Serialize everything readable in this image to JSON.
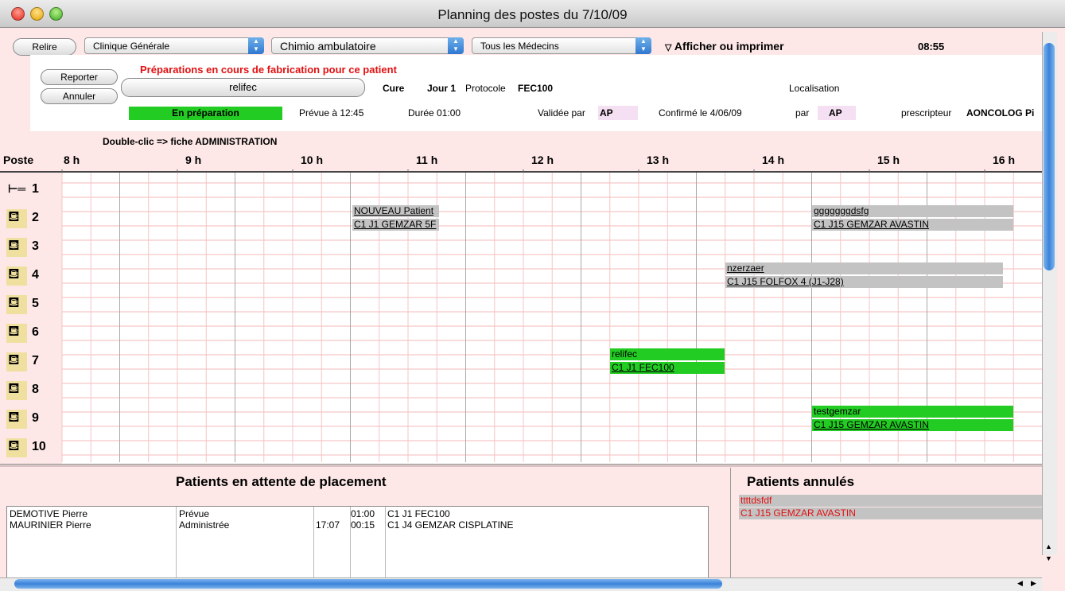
{
  "window": {
    "title": "Planning des postes du 7/10/09"
  },
  "toolbar": {
    "reload_label": "Relire",
    "clinic_select": "Clinique Générale",
    "service_select": "Chimio ambulatoire",
    "doctor_select": "Tous les Médecins",
    "display_print_label": "Afficher ou imprimer",
    "time": "08:55"
  },
  "patient_panel": {
    "header": "Préparations en cours de fabrication pour ce patient",
    "postpone_label": "Reporter",
    "cancel_label": "Annuler",
    "patient_name": "relifec",
    "cure_label": "Cure",
    "day": "Jour 1",
    "protocol_label": "Protocole",
    "protocol": "FEC100",
    "localisation_label": "Localisation",
    "status": "En préparation",
    "planned": "Prévue à 12:45",
    "duration": "Durée 01:00",
    "validated_by_label": "Validée par",
    "validated_by": "AP",
    "confirmed": "Confirmé le 4/06/09",
    "par_label": "par",
    "par_value": "AP",
    "prescriber_label": "prescripteur",
    "prescriber": "AONCOLOG Pi",
    "status_color": "#22cc22"
  },
  "grid": {
    "hint": "Double-clic => fiche ADMINISTRATION",
    "poste_label": "Poste",
    "hours": [
      "8 h",
      "9 h",
      "10 h",
      "11 h",
      "12 h",
      "13 h",
      "14 h",
      "15 h",
      "16 h"
    ],
    "rows": [
      {
        "num": "1",
        "icon": "bed-icon"
      },
      {
        "num": "2",
        "icon": "chair-icon"
      },
      {
        "num": "3",
        "icon": "chair-icon"
      },
      {
        "num": "4",
        "icon": "chair-icon"
      },
      {
        "num": "5",
        "icon": "chair-icon"
      },
      {
        "num": "6",
        "icon": "chair-icon"
      },
      {
        "num": "7",
        "icon": "chair-icon"
      },
      {
        "num": "8",
        "icon": "chair-icon"
      },
      {
        "num": "9",
        "icon": "chair-icon"
      },
      {
        "num": "10",
        "icon": "chair-icon"
      }
    ],
    "events": [
      {
        "poste": "2",
        "color": "grey",
        "patient": "NOUVEAU Patient",
        "protocol": "C1 J1 GEMZAR 5F"
      },
      {
        "poste": "2",
        "color": "grey",
        "patient": "gggggggdsfg",
        "protocol": "C1 J15 GEMZAR AVASTIN"
      },
      {
        "poste": "4",
        "color": "grey",
        "patient": "nzerzaer",
        "protocol": "C1 J15 FOLFOX 4 (J1-J28)"
      },
      {
        "poste": "7",
        "color": "green",
        "patient": "relifec",
        "protocol": "C1 J1 FEC100"
      },
      {
        "poste": "9",
        "color": "green",
        "patient": "testgemzar",
        "protocol": "C1 J15 GEMZAR AVASTIN"
      }
    ]
  },
  "waiting": {
    "title": "Patients en attente de placement",
    "rows": [
      {
        "name": "DEMOTIVE Pierre",
        "status": "Prévue",
        "time": "",
        "duration": "01:00",
        "protocol": "C1 J1 FEC100"
      },
      {
        "name": "MAURINIER Pierre",
        "status": "Administrée",
        "time": "17:07",
        "duration": "00:15",
        "protocol": "C1 J4 GEMZAR CISPLATINE"
      }
    ]
  },
  "cancelled": {
    "title": "Patients annulés",
    "patient": "ttttdsfdf",
    "protocol": "C1 J15 GEMZAR AVASTIN"
  }
}
